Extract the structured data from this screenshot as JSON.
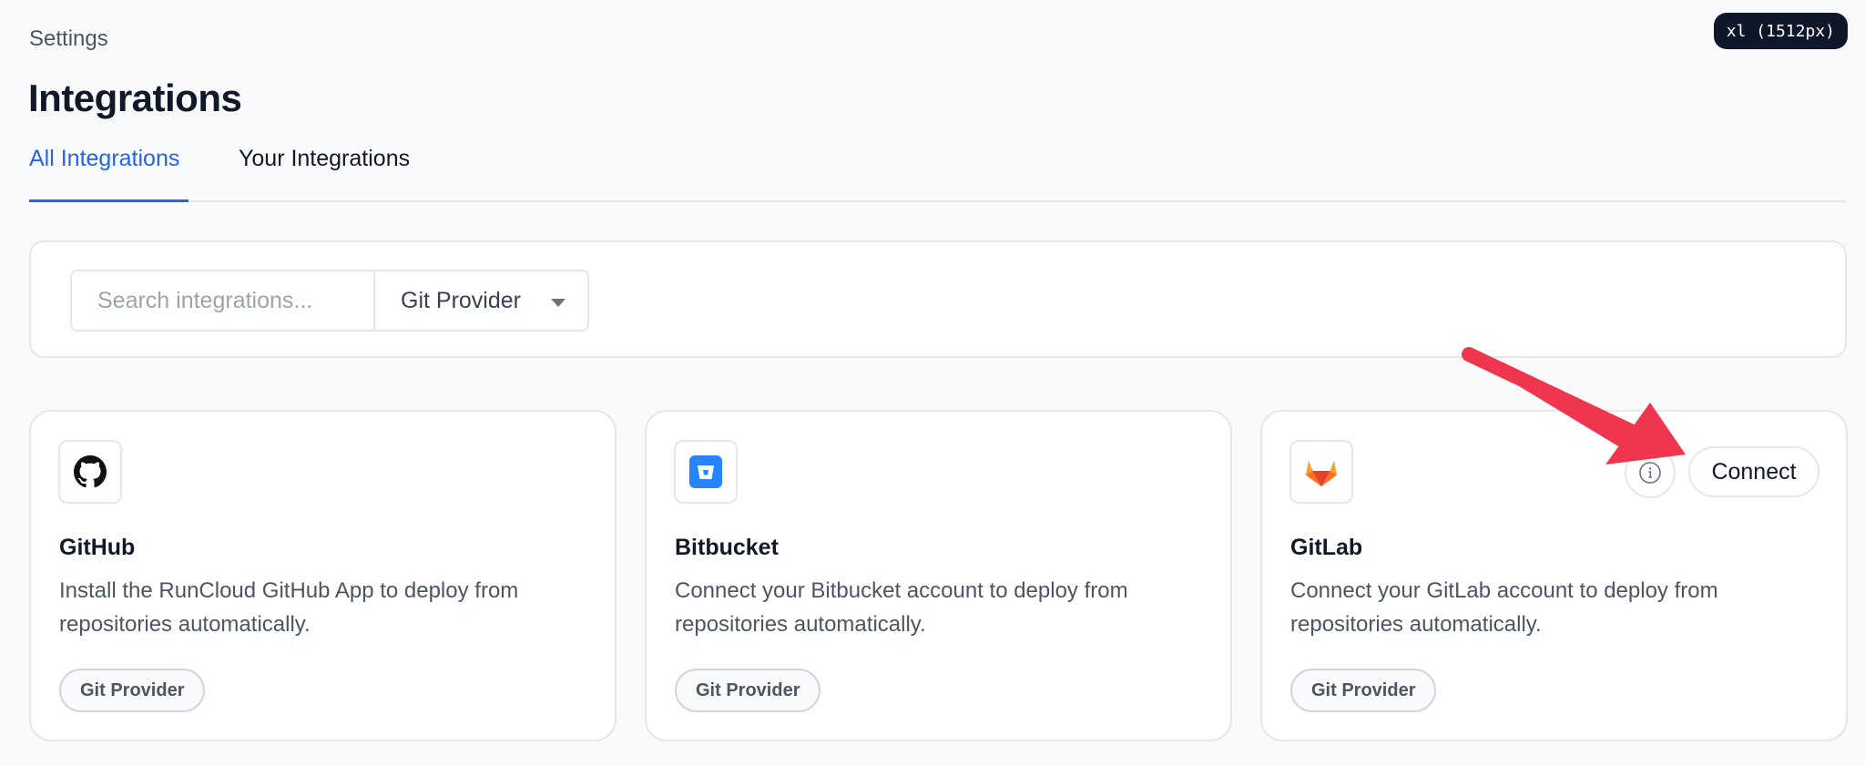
{
  "breakpoint_badge": "xl (1512px)",
  "breadcrumb": "Settings",
  "page_title": "Integrations",
  "tabs": [
    {
      "label": "All Integrations",
      "active": true
    },
    {
      "label": "Your Integrations",
      "active": false
    }
  ],
  "filters": {
    "search_placeholder": "Search integrations...",
    "search_value": "",
    "category_selected": "Git Provider"
  },
  "integrations": [
    {
      "name": "GitHub",
      "description": "Install the RunCloud GitHub App to deploy from repositories automatically.",
      "category": "Git Provider",
      "icon": "github-icon"
    },
    {
      "name": "Bitbucket",
      "description": "Connect your Bitbucket account to deploy from repositories automatically.",
      "category": "Git Provider",
      "icon": "bitbucket-icon"
    },
    {
      "name": "GitLab",
      "description": "Connect your GitLab account to deploy from repositories automatically.",
      "category": "Git Provider",
      "icon": "gitlab-icon",
      "connect_label": "Connect",
      "info_icon": "info-icon"
    }
  ],
  "colors": {
    "accent": "#2563eb",
    "annotation_arrow": "#f0364e",
    "bitbucket": "#2684ff",
    "gitlab": "#e24329"
  }
}
